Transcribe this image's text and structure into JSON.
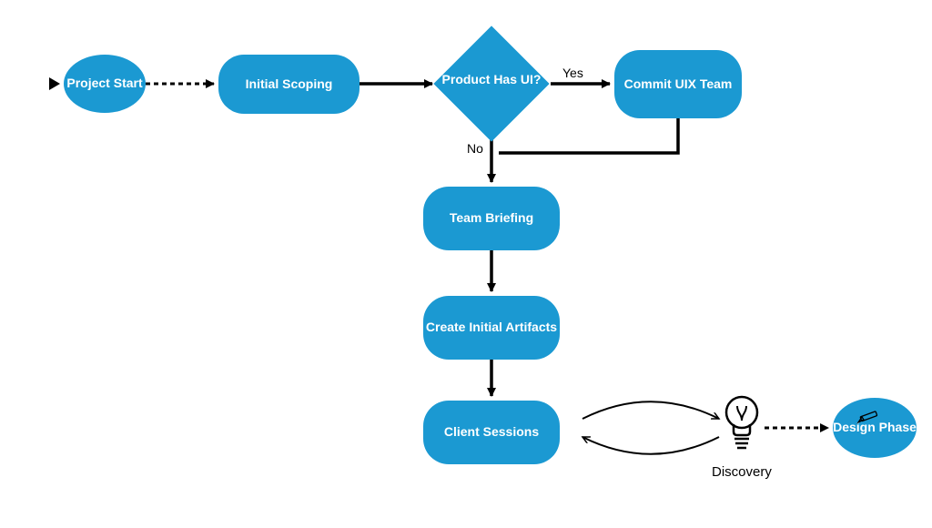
{
  "colors": {
    "blue": "#1b99d2"
  },
  "nodes": {
    "project_start": "Project Start",
    "initial_scoping": "Initial Scoping",
    "decision": "Product Has UI?",
    "commit_uix": "Commit UIX Team",
    "team_briefing": "Team Briefing",
    "create_artifacts": "Create Initial Artifacts",
    "client_sessions": "Client Sessions",
    "design_phase": "Design Phase"
  },
  "edges": {
    "yes": "Yes",
    "no": "No"
  },
  "captions": {
    "discovery": "Discovery"
  }
}
